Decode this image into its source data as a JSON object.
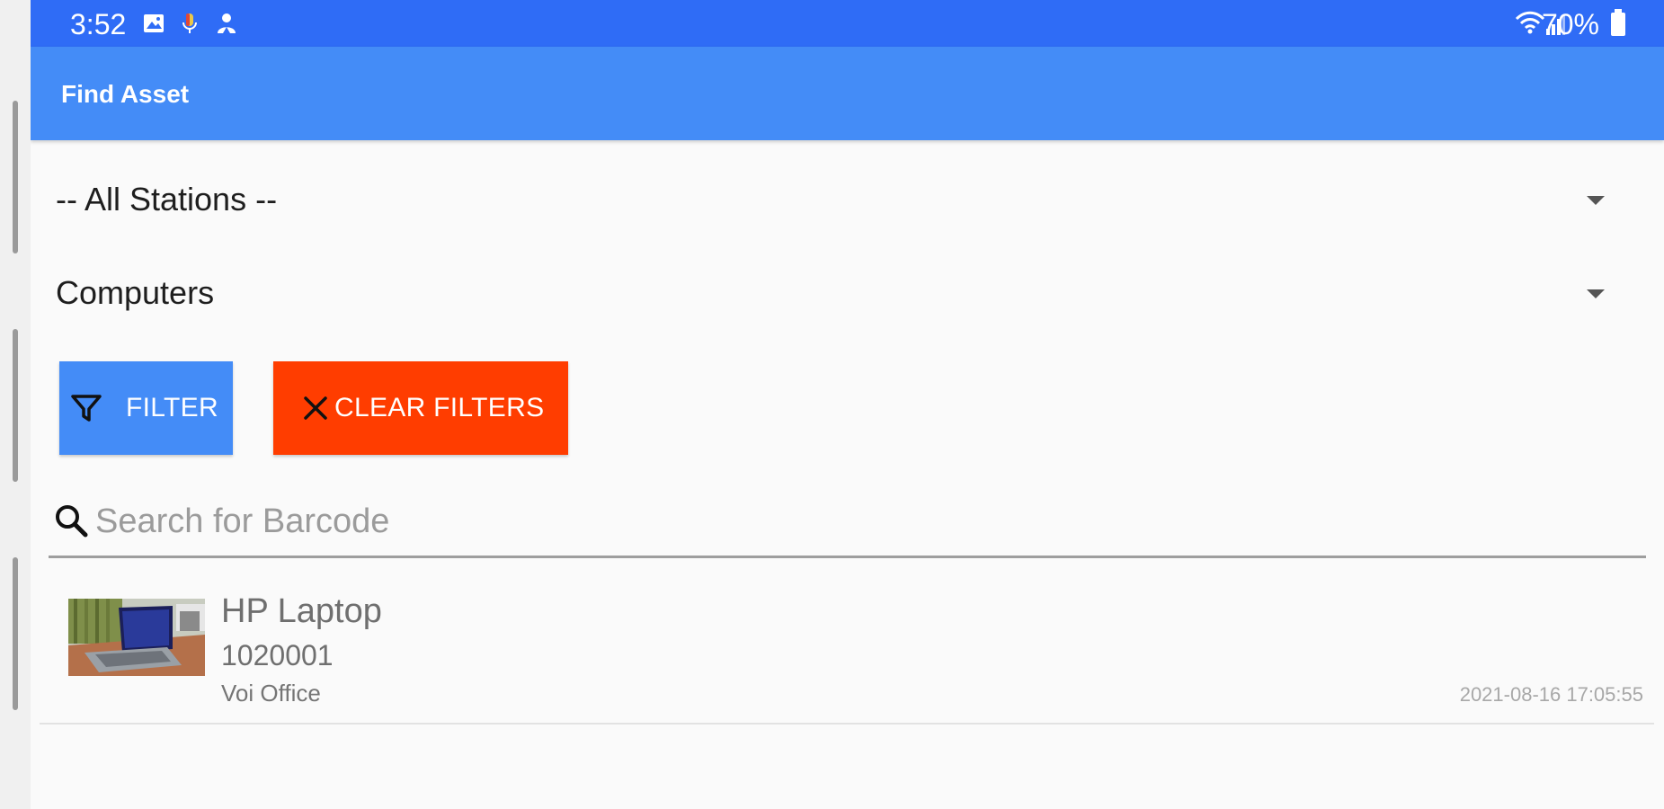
{
  "status_bar": {
    "time": "3:52",
    "battery": "70%",
    "icons": [
      "image-icon",
      "mic-icon",
      "person-icon",
      "wifi-icon",
      "signal-icon",
      "battery-icon"
    ]
  },
  "app_bar": {
    "title": "Find Asset"
  },
  "filters": {
    "station": "-- All Stations --",
    "category": "Computers",
    "filter_label": "FILTER",
    "clear_label": "CLEAR FILTERS"
  },
  "search": {
    "placeholder": "Search for Barcode",
    "value": ""
  },
  "assets": [
    {
      "name": "HP Laptop",
      "barcode": "1020001",
      "location": "Voi Office",
      "date": "2021-08-16 17:05:55",
      "thumbnail": "laptop-photo"
    }
  ],
  "colors": {
    "status_bar": "#2f6cf6",
    "app_bar": "#448cf7",
    "filter_button": "#448cf7",
    "clear_button": "#ff3d00",
    "background": "#fafafa"
  }
}
